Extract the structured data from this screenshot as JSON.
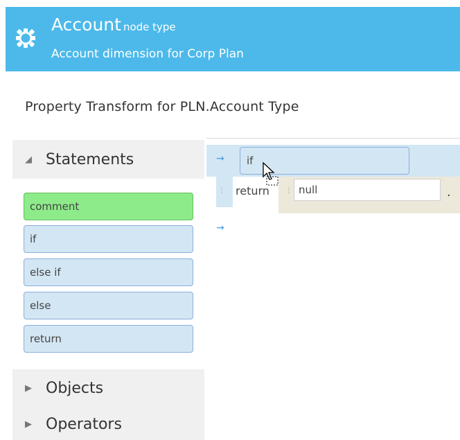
{
  "header": {
    "title": "Account",
    "title_suffix": "node type",
    "description": "Account dimension for Corp Plan",
    "icon": "gear-icon",
    "bg_color": "#4cb9ea"
  },
  "page_title": "Property Transform for PLN.Account Type",
  "sidebar": {
    "statements_label": "Statements",
    "statement_items": [
      "comment",
      "if",
      "else if",
      "else",
      "return"
    ],
    "objects_label": "Objects",
    "operators_label": "Operators"
  },
  "canvas": {
    "if_label": "if",
    "return_label": "return",
    "return_value": "null",
    "terminator": "."
  }
}
